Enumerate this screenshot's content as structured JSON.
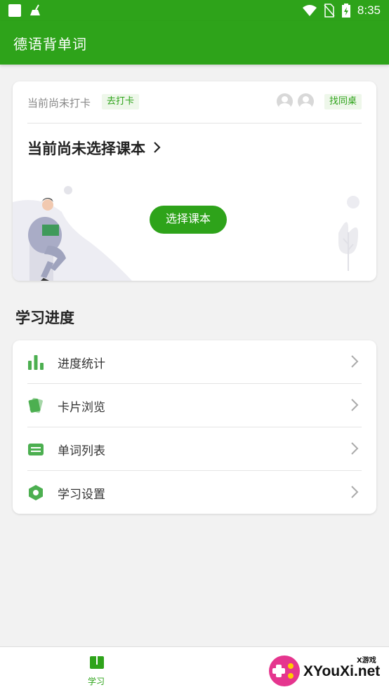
{
  "status_bar": {
    "time": "8:35"
  },
  "app_bar": {
    "title": "德语背单词"
  },
  "checkin": {
    "status_text": "当前尚未打卡",
    "checkin_tag": "去打卡",
    "find_table_tag": "找同桌"
  },
  "textbook": {
    "title": "当前尚未选择课本",
    "choose_button": "选择课本"
  },
  "progress_section": {
    "title": "学习进度",
    "items": [
      {
        "label": "进度统计",
        "icon": "bar-chart-icon"
      },
      {
        "label": "卡片浏览",
        "icon": "cards-icon"
      },
      {
        "label": "单词列表",
        "icon": "list-icon"
      },
      {
        "label": "学习设置",
        "icon": "settings-hexagon-icon"
      }
    ]
  },
  "bottom_nav": {
    "tabs": [
      {
        "label": "学习",
        "icon": "book-icon",
        "active": true
      }
    ]
  },
  "watermark": {
    "text": "XYouXi.net",
    "sub": "X游戏"
  },
  "colors": {
    "primary": "#2ea31a",
    "background": "#f2f2f2",
    "tag_bg": "#eef7ea"
  }
}
